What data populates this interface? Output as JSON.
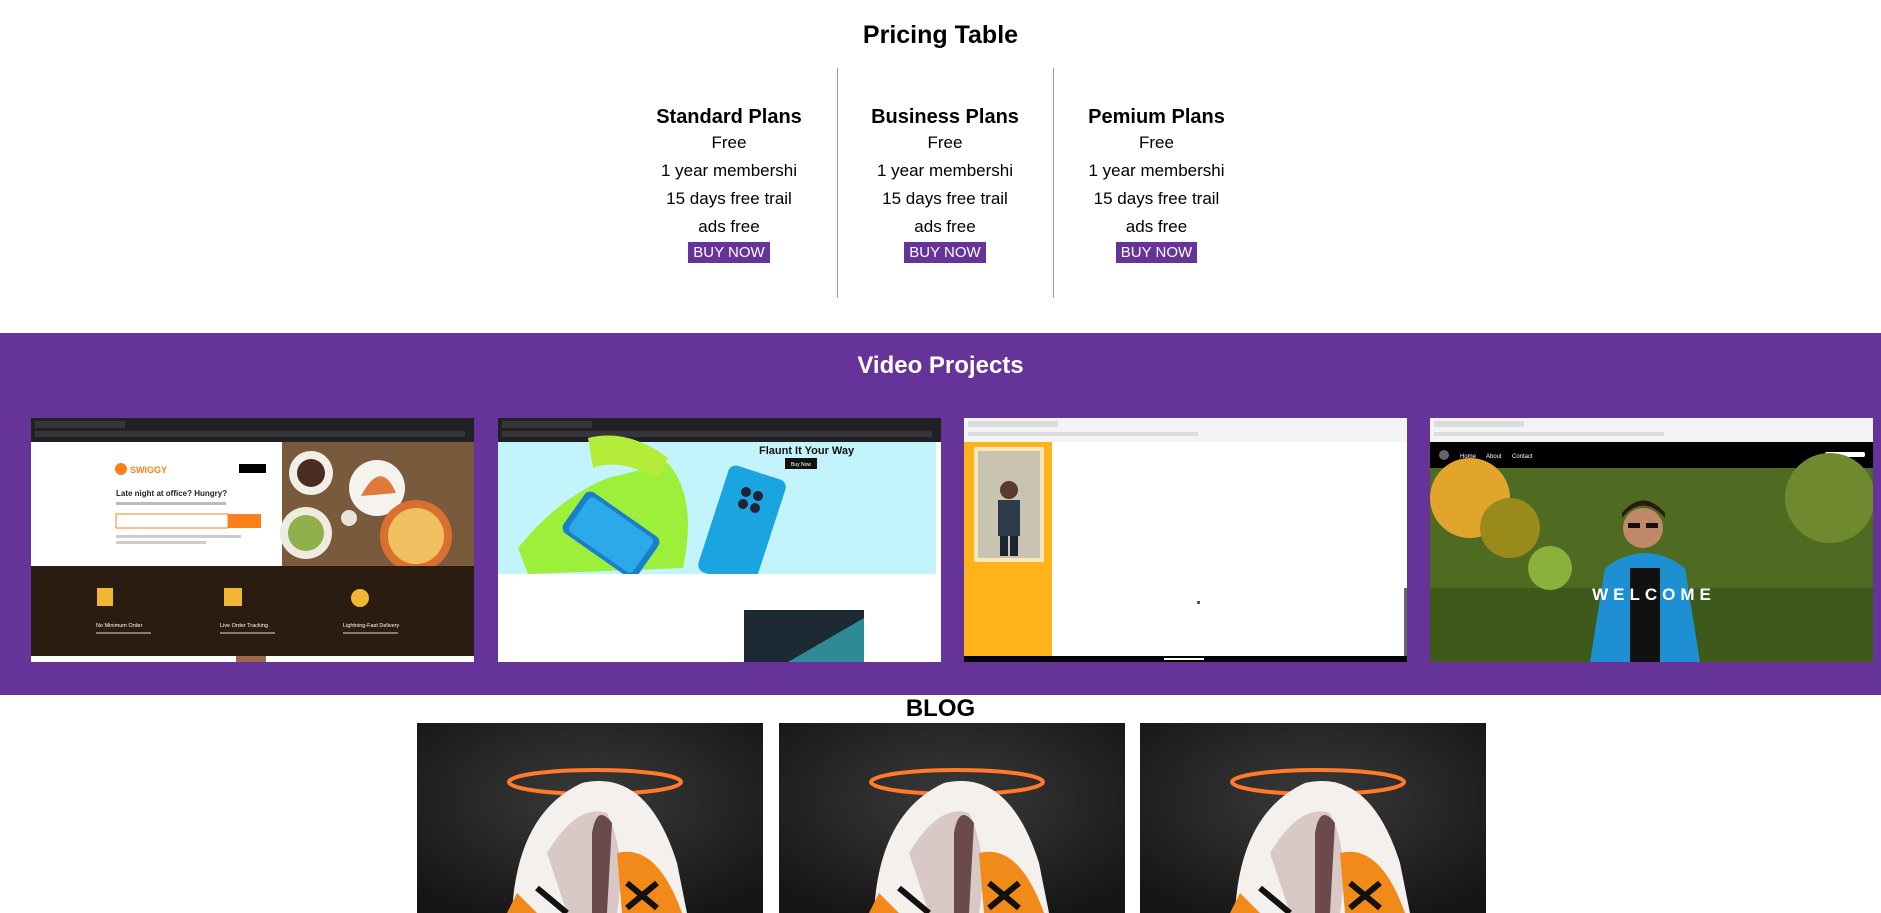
{
  "pricing": {
    "title": "Pricing Table",
    "plans": [
      {
        "name": "Standard Plans",
        "price": "Free",
        "features": [
          "1 year membershi",
          "15 days free trail",
          "ads free"
        ],
        "button": "BUY NOW"
      },
      {
        "name": "Business Plans",
        "price": "Free",
        "features": [
          "1 year membershi",
          "15 days free trail",
          "ads free"
        ],
        "button": "BUY NOW"
      },
      {
        "name": "Pemium Plans",
        "price": "Free",
        "features": [
          "1 year membershi",
          "15 days free trail",
          "ads free"
        ],
        "button": "BUY NOW"
      }
    ]
  },
  "video": {
    "title": "Video Projects",
    "thumbs": [
      {
        "brand": "SWIGGY",
        "headline": "Late night at office? Hungry?",
        "features": [
          "No Minimum Order",
          "Live Order Tracking",
          "Lightning-Fast Delivery"
        ]
      },
      {
        "headline": "Flaunt It Your Way",
        "cta": "Buy Now"
      },
      {},
      {
        "nav": [
          "Home",
          "About",
          "Contact"
        ],
        "hero": "WELCOME"
      }
    ]
  },
  "blog": {
    "title": "BLOG"
  },
  "colors": {
    "accent": "#663399",
    "swiggy": "#fc8019",
    "yellow": "#ffb31a"
  }
}
